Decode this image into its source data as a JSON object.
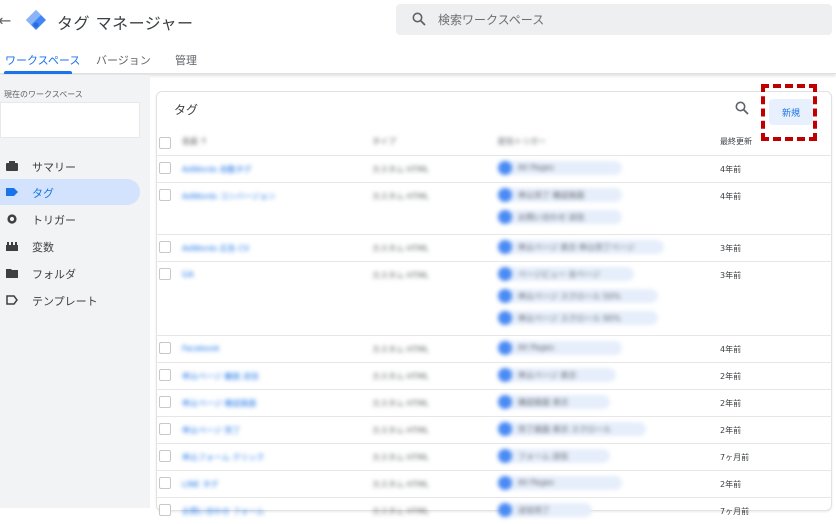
{
  "header": {
    "title": "タグ マネージャー",
    "search_placeholder": "検索ワークスペース"
  },
  "tabs": [
    {
      "label": "ワークスペース",
      "active": true
    },
    {
      "label": "バージョン",
      "active": false
    },
    {
      "label": "管理",
      "active": false
    }
  ],
  "sidebar": {
    "workspace_label": "現在のワークスペース",
    "items": [
      {
        "label": "サマリー",
        "icon": "summary-icon",
        "active": false
      },
      {
        "label": "タグ",
        "icon": "tag-icon",
        "active": true
      },
      {
        "label": "トリガー",
        "icon": "trigger-icon",
        "active": false
      },
      {
        "label": "変数",
        "icon": "variable-icon",
        "active": false
      },
      {
        "label": "フォルダ",
        "icon": "folder-icon",
        "active": false
      },
      {
        "label": "テンプレート",
        "icon": "template-icon",
        "active": false
      }
    ]
  },
  "card": {
    "title": "タグ",
    "new_button": "新規",
    "columns": {
      "name": "名前 ↑",
      "type": "タイプ",
      "trigger": "配信トリガー",
      "updated": "最終更新"
    }
  },
  "rows": [
    {
      "name": "AdWords 自動タグ",
      "type": "カスタム HTML",
      "triggers": [
        "All Pages"
      ],
      "updated": "4年前"
    },
    {
      "name": "AdWords コンバージョン",
      "type": "カスタム HTML",
      "triggers": [
        "申込完了 確認画面",
        "お問い合わせ 送信"
      ],
      "updated": "4年前"
    },
    {
      "name": "AdWords 広告 CV",
      "type": "カスタム HTML",
      "triggers": [
        "申込ページ 表示 申込完了ページ"
      ],
      "updated": "3年前"
    },
    {
      "name": "GA",
      "type": "カスタム HTML",
      "triggers": [
        "ページビュー 全ページ",
        "申込ページ スクロール 50%",
        "申込ページ スクロール 90%"
      ],
      "updated": "3年前"
    },
    {
      "name": "Facebook",
      "type": "カスタム HTML",
      "triggers": [
        "All Pages"
      ],
      "updated": "4年前"
    },
    {
      "name": "申込ページ 離脱 送信",
      "type": "カスタム HTML",
      "triggers": [
        "申込ページ 表示"
      ],
      "updated": "2年前"
    },
    {
      "name": "申込ページ 確認画面",
      "type": "カスタム HTML",
      "triggers": [
        "確認画面 表示"
      ],
      "updated": "2年前"
    },
    {
      "name": "申込ページ 完了",
      "type": "カスタム HTML",
      "triggers": [
        "完了画面 表示 スクロール"
      ],
      "updated": "2年前"
    },
    {
      "name": "申込フォーム クリック",
      "type": "カスタム HTML",
      "triggers": [
        "フォーム 送信"
      ],
      "updated": "7ヶ月前"
    },
    {
      "name": "LINE タグ",
      "type": "カスタム HTML",
      "triggers": [
        "All Pages"
      ],
      "updated": "2年前"
    },
    {
      "name": "お問い合わせ フォーム",
      "type": "カスタム HTML",
      "triggers": [
        "送信完了"
      ],
      "updated": "7ヶ月前"
    }
  ],
  "colors": {
    "accent": "#1a73e8",
    "highlight": "#c00000"
  }
}
